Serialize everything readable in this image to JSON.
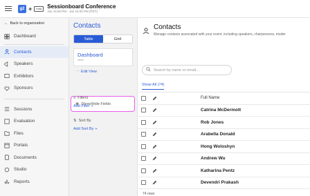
{
  "topbar": {
    "logo_text": "g2",
    "plus": "+",
    "partner_logo_text": "mna",
    "event_title": "Sessionboard Conference",
    "event_date": "Jan 15:00 PM - Jan 15:00 PM (PDT)"
  },
  "sidebar": {
    "back_label": "Back to organization",
    "items": [
      {
        "label": "Dashboard",
        "icon": "dashboard-icon"
      },
      {
        "label": "Contacts",
        "icon": "person-icon"
      },
      {
        "label": "Speakers",
        "icon": "megaphone-icon"
      },
      {
        "label": "Exhibitors",
        "icon": "exhibitor-icon"
      },
      {
        "label": "Sponsors",
        "icon": "sponsor-icon"
      },
      {
        "label": "Sessions",
        "icon": "sessions-icon"
      },
      {
        "label": "Evaluation",
        "icon": "evaluation-icon"
      },
      {
        "label": "Files",
        "icon": "files-icon"
      },
      {
        "label": "Portals",
        "icon": "portals-icon"
      },
      {
        "label": "Documents",
        "icon": "documents-icon"
      },
      {
        "label": "Studio",
        "icon": "studio-icon"
      },
      {
        "label": "Reports",
        "icon": "reports-icon"
      }
    ]
  },
  "views": {
    "title": "Contacts",
    "toggle_table": "Table",
    "toggle_grid": "Grid",
    "view_name": "Dashboard",
    "view_sub": "views",
    "edit_view": "Edit View",
    "show_hide": "Show/Hide Fields",
    "filters_label": "Filters",
    "add_filter": "Add Filter",
    "sort_label": "Sort By",
    "add_sort": "Add Sort By"
  },
  "main": {
    "title": "Contacts",
    "subtitle": "Manage contacts associated with your event, including speakers, chairpersons, moder",
    "search_placeholder": "Search by name or email...",
    "tab_label": "Show All (74)",
    "column_header": "Full Name",
    "rows": [
      "Catrina McDermott",
      "Rob Jones",
      "Arabella Donald",
      "Hong Woloshyn",
      "Andrew Wu",
      "Katharina Pentz",
      "Devendri Prakash"
    ],
    "row_count": "74 rows"
  }
}
